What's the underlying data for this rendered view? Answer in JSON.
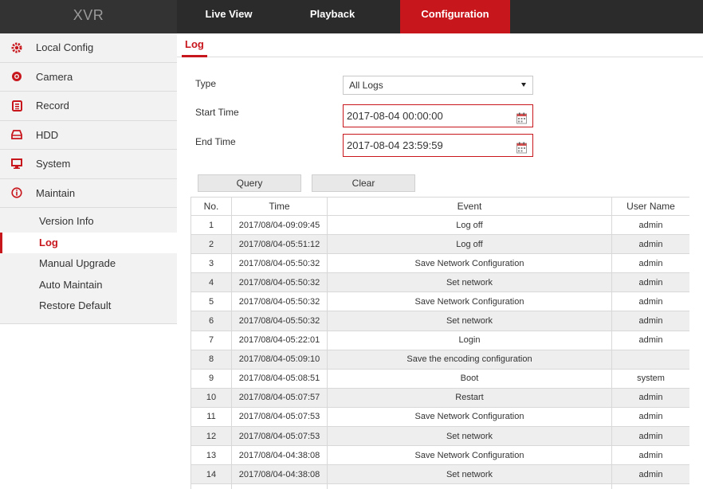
{
  "header": {
    "brand": "XVR",
    "tabs": [
      {
        "label": "Live View"
      },
      {
        "label": "Playback"
      },
      {
        "label": "Configuration"
      }
    ]
  },
  "sidebar": {
    "items": [
      {
        "label": "Local Config",
        "icon": "gear-icon"
      },
      {
        "label": "Camera",
        "icon": "camera-icon"
      },
      {
        "label": "Record",
        "icon": "record-icon"
      },
      {
        "label": "HDD",
        "icon": "hdd-icon"
      },
      {
        "label": "System",
        "icon": "monitor-icon"
      },
      {
        "label": "Maintain",
        "icon": "info-icon"
      }
    ],
    "submenu": [
      {
        "label": "Version Info"
      },
      {
        "label": "Log"
      },
      {
        "label": "Manual Upgrade"
      },
      {
        "label": "Auto Maintain"
      },
      {
        "label": "Restore Default"
      }
    ]
  },
  "page": {
    "title": "Log",
    "type_label": "Type",
    "type_value": "All Logs",
    "start_label": "Start Time",
    "start_value": "2017-08-04 00:00:00",
    "end_label": "End Time",
    "end_value": "2017-08-04 23:59:59",
    "query_label": "Query",
    "clear_label": "Clear"
  },
  "table": {
    "headers": [
      "No.",
      "Time",
      "Event",
      "User Name"
    ],
    "rows": [
      [
        "1",
        "2017/08/04-09:09:45",
        "Log off",
        "admin"
      ],
      [
        "2",
        "2017/08/04-05:51:12",
        "Log off",
        "admin"
      ],
      [
        "3",
        "2017/08/04-05:50:32",
        "Save Network Configuration",
        "admin"
      ],
      [
        "4",
        "2017/08/04-05:50:32",
        "Set network",
        "admin"
      ],
      [
        "5",
        "2017/08/04-05:50:32",
        "Save Network Configuration",
        "admin"
      ],
      [
        "6",
        "2017/08/04-05:50:32",
        "Set network",
        "admin"
      ],
      [
        "7",
        "2017/08/04-05:22:01",
        "Login",
        "admin"
      ],
      [
        "8",
        "2017/08/04-05:09:10",
        "Save the encoding configuration",
        ""
      ],
      [
        "9",
        "2017/08/04-05:08:51",
        "Boot",
        "system"
      ],
      [
        "10",
        "2017/08/04-05:07:57",
        "Restart",
        "admin"
      ],
      [
        "11",
        "2017/08/04-05:07:53",
        "Save Network Configuration",
        "admin"
      ],
      [
        "12",
        "2017/08/04-05:07:53",
        "Set network",
        "admin"
      ],
      [
        "13",
        "2017/08/04-04:38:08",
        "Save Network Configuration",
        "admin"
      ],
      [
        "14",
        "2017/08/04-04:38:08",
        "Set network",
        "admin"
      ],
      [
        "",
        "",
        "",
        ""
      ]
    ]
  },
  "colors": {
    "accent": "#c8161d",
    "topbar": "#2b2b2b",
    "sidebar_bg": "#f2f2f2"
  }
}
